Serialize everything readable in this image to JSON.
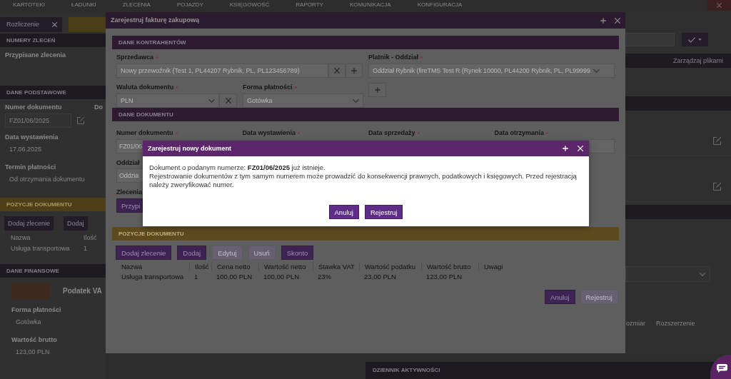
{
  "top_nav": {
    "items": [
      "KARTOTEKI",
      "ŁADUNKI",
      "ZLECENIA",
      "POJAZDY",
      "KSIĘGOWOŚĆ",
      "RAPORTY",
      "KOMUNIKACJA",
      "KONFIGURACJA"
    ]
  },
  "left_panel": {
    "tabs": [
      {
        "label": "Rozliczenie",
        "selected": true,
        "closable": true
      },
      {
        "selected": false,
        "closable": false
      }
    ],
    "sections": [
      {
        "title": "NUMERY ZLECEŃ",
        "accent": false,
        "blocks": [
          {
            "kind": "label",
            "text": "Przypisane zlecenia"
          }
        ]
      },
      {
        "title": "DANE PODSTAWOWE",
        "accent": false,
        "blocks": [
          {
            "kind": "field_pair",
            "labels": [
              "Numer dokumentu",
              "Do"
            ],
            "value": "FZ01/06/2025"
          },
          {
            "kind": "value",
            "label": "Data wystawienia",
            "value": "17.06.2025"
          },
          {
            "kind": "value",
            "label": "Termin płatności",
            "value": "Od otrzymania dokumentu"
          }
        ]
      },
      {
        "title": "POZYCJE DOKUMENTU",
        "accent": true,
        "blocks": [
          {
            "kind": "buttons",
            "buttons": [
              "Dodaj zlecenie",
              "Dodaj"
            ]
          },
          {
            "kind": "table",
            "columns": [
              "Nazwa",
              "Ilość"
            ],
            "rows": [
              [
                "Usługa transportowa",
                "1"
              ]
            ]
          }
        ]
      },
      {
        "title": "DANE FINANSOWE",
        "accent": false,
        "blocks": [
          {
            "kind": "tax_row",
            "label": "Podatek VA"
          },
          {
            "kind": "value",
            "label": "Forma płatności",
            "value": "Gotówka"
          },
          {
            "kind": "value",
            "label": "Wartość brutto",
            "value": "123,00 PLN"
          }
        ]
      }
    ]
  },
  "right_panel": {
    "header": "Zarządzaj plikami",
    "columns": [
      "ozmiar",
      "Rozszerzenie"
    ]
  },
  "activity_log": {
    "title": "DZIENNIK AKTYWNOŚCI"
  },
  "invoice_dialog": {
    "title": "Zarejestruj fakturę zakupową",
    "contractors": {
      "title": "DANE KONTRAHENTÓW",
      "accent": false,
      "seller": {
        "label": "Sprzedawca",
        "required": true,
        "value": "Nowy przewoźnik (Test 1, PL44207 Rybnik, PL, PL123456789)"
      },
      "payer": {
        "label": "Platnik - Oddział",
        "required": true,
        "value": "Oddział Rybnik (fireTMS Test R (Rynek 10000, PL44200 Rybnik, PL, PL99999"
      },
      "currency": {
        "label": "Waluta dokumentu",
        "required": true,
        "value": "PLN"
      },
      "payment_method": {
        "label": "Forma płatności",
        "required": true,
        "value": "Gotówka"
      }
    },
    "document": {
      "title": "DANE DOKUMENTU",
      "accent": false,
      "fields": [
        {
          "label": "Numer dokumentu",
          "required": true,
          "value": "FZ01/06"
        },
        {
          "label": "Data wystawienia",
          "required": true
        },
        {
          "label": "Data sprzedaży",
          "required": true
        },
        {
          "label": "Data otrzymania",
          "required": true
        }
      ],
      "branch": {
        "label": "Oddział",
        "value": "Oddzia"
      },
      "orders": {
        "label": "Zlecenia",
        "button": "Przypi"
      }
    },
    "items": {
      "title": "POZYCJE DOKUMENTU",
      "accent": true,
      "buttons": [
        {
          "label": "Dodaj zlecenie",
          "disabled": false
        },
        {
          "label": "Dodaj",
          "disabled": false
        },
        {
          "label": "Edytuj",
          "disabled": true
        },
        {
          "label": "Usuń",
          "disabled": true
        },
        {
          "label": "Skonto",
          "disabled": false
        }
      ],
      "columns": [
        "Nazwa",
        "Ilość",
        "Cena netto",
        "Wartość netto",
        "Stawka VAT",
        "Wartość podatku",
        "Wartość brutto",
        "Uwagi"
      ],
      "rows": [
        [
          "Usługa transportowa",
          "1",
          "100,00 PLN",
          "100,00 PLN",
          "23%",
          "23,00 PLN",
          "123,00 PLN"
        ]
      ]
    },
    "buttons": [
      {
        "label": "Anuluj",
        "disabled": false
      },
      {
        "label": "Rejestruj",
        "disabled": true
      }
    ]
  },
  "confirm_dialog": {
    "title": "Zarejestruj nowy dokument",
    "message": [
      "Dokument o podanym numerze: **FZ01/06/2025** już istnieje.",
      "Rejestrowanie dokumentów z tym samym numerem może prowadzić do konsekwencji prawnych, podatkowych i księgowych. Przed rejestracją należy zweryfikować numer."
    ],
    "buttons": [
      {
        "label": "Anuluj"
      },
      {
        "label": "Rejestruj"
      }
    ]
  }
}
